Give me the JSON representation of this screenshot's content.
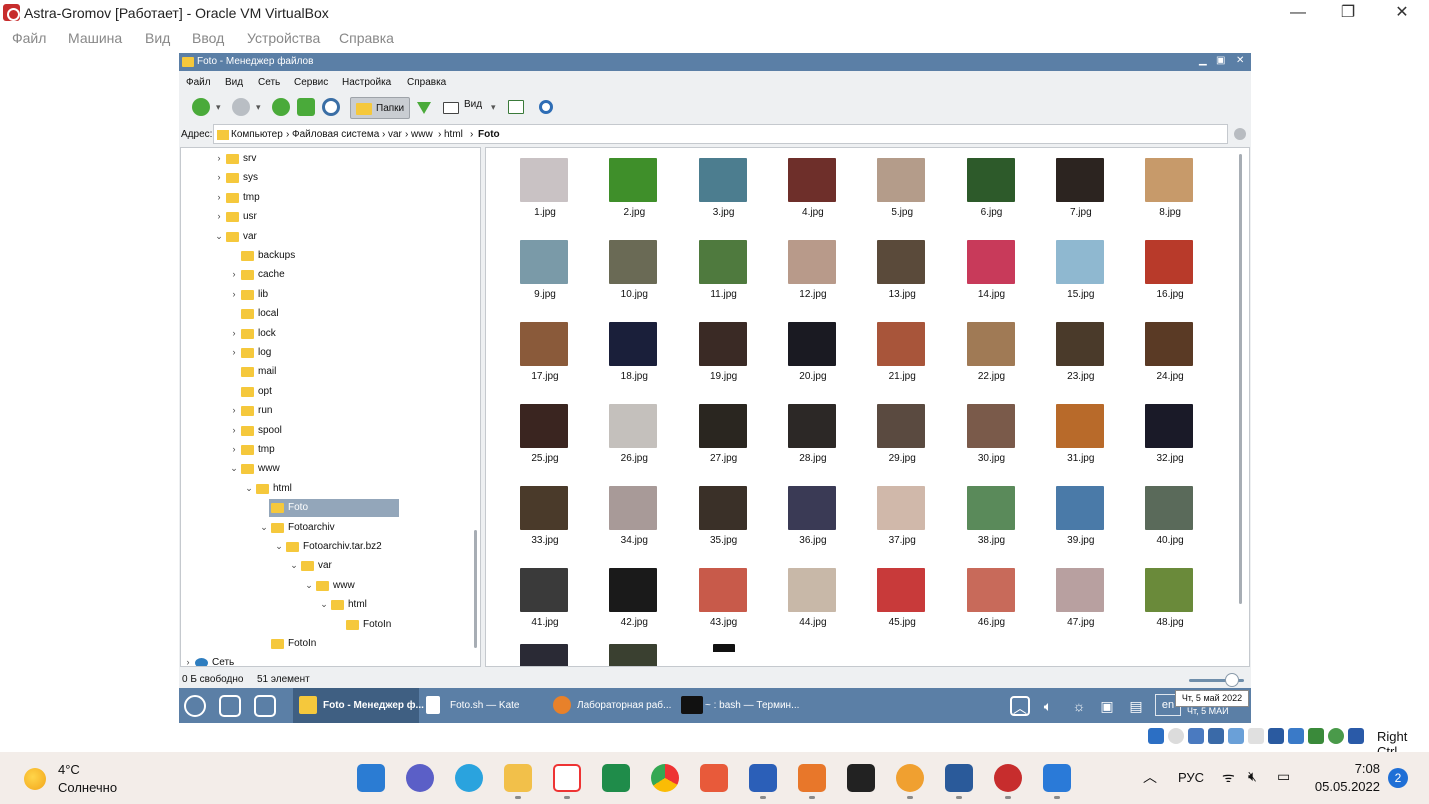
{
  "host": {
    "title": "Astra-Gromov [Работает] - Oracle VM VirtualBox",
    "menu": [
      "Файл",
      "Машина",
      "Вид",
      "Ввод",
      "Устройства",
      "Справка"
    ],
    "host_key_label": "Right Ctrl"
  },
  "filemanager": {
    "title": "Foto - Менеджер файлов",
    "menu": [
      "Файл",
      "Вид",
      "Сеть",
      "Сервис",
      "Настройка",
      "Справка"
    ],
    "toolbar": {
      "folders_label": "Папки",
      "view_label": "Вид"
    },
    "address": {
      "label": "Адрес:",
      "crumbs": [
        "Компьютер",
        "Файловая система",
        "var",
        "www",
        "html",
        "Foto"
      ]
    },
    "tree": [
      {
        "label": "srv",
        "depth": 0,
        "exp": ">"
      },
      {
        "label": "sys",
        "depth": 0,
        "exp": ">"
      },
      {
        "label": "tmp",
        "depth": 0,
        "exp": ">"
      },
      {
        "label": "usr",
        "depth": 0,
        "exp": ">"
      },
      {
        "label": "var",
        "depth": 0,
        "exp": "v"
      },
      {
        "label": "backups",
        "depth": 1,
        "exp": ""
      },
      {
        "label": "cache",
        "depth": 1,
        "exp": ">"
      },
      {
        "label": "lib",
        "depth": 1,
        "exp": ">"
      },
      {
        "label": "local",
        "depth": 1,
        "exp": ""
      },
      {
        "label": "lock",
        "depth": 1,
        "exp": ">"
      },
      {
        "label": "log",
        "depth": 1,
        "exp": ">"
      },
      {
        "label": "mail",
        "depth": 1,
        "exp": ""
      },
      {
        "label": "opt",
        "depth": 1,
        "exp": ""
      },
      {
        "label": "run",
        "depth": 1,
        "exp": ">"
      },
      {
        "label": "spool",
        "depth": 1,
        "exp": ">"
      },
      {
        "label": "tmp",
        "depth": 1,
        "exp": ">"
      },
      {
        "label": "www",
        "depth": 1,
        "exp": "v"
      },
      {
        "label": "html",
        "depth": 2,
        "exp": "v"
      },
      {
        "label": "Foto",
        "depth": 3,
        "exp": "",
        "selected": true
      },
      {
        "label": "Fotoarchiv",
        "depth": 3,
        "exp": "v"
      },
      {
        "label": "Fotoarchiv.tar.bz2",
        "depth": 4,
        "exp": "v"
      },
      {
        "label": "var",
        "depth": 5,
        "exp": "v"
      },
      {
        "label": "www",
        "depth": 6,
        "exp": "v"
      },
      {
        "label": "html",
        "depth": 7,
        "exp": "v"
      },
      {
        "label": "FotoIn",
        "depth": 8,
        "exp": ""
      },
      {
        "label": "FotoIn",
        "depth": 3,
        "exp": ""
      },
      {
        "label": "Сеть",
        "depth": -1,
        "exp": ">"
      }
    ],
    "files": [
      "1.jpg",
      "2.jpg",
      "3.jpg",
      "4.jpg",
      "5.jpg",
      "6.jpg",
      "7.jpg",
      "8.jpg",
      "9.jpg",
      "10.jpg",
      "11.jpg",
      "12.jpg",
      "13.jpg",
      "14.jpg",
      "15.jpg",
      "16.jpg",
      "17.jpg",
      "18.jpg",
      "19.jpg",
      "20.jpg",
      "21.jpg",
      "22.jpg",
      "23.jpg",
      "24.jpg",
      "25.jpg",
      "26.jpg",
      "27.jpg",
      "28.jpg",
      "29.jpg",
      "30.jpg",
      "31.jpg",
      "32.jpg",
      "33.jpg",
      "34.jpg",
      "35.jpg",
      "36.jpg",
      "37.jpg",
      "38.jpg",
      "39.jpg",
      "40.jpg",
      "41.jpg",
      "42.jpg",
      "43.jpg",
      "44.jpg",
      "45.jpg",
      "46.jpg",
      "47.jpg",
      "48.jpg"
    ],
    "thumb_colors": [
      "#c9c2c4",
      "#3f8f2a",
      "#4c7d8f",
      "#6e2f2a",
      "#b49c8a",
      "#2d5a2a",
      "#2c2420",
      "#c79a6a",
      "#7a9aa8",
      "#6a6a55",
      "#4f7a3e",
      "#b89a8a",
      "#5a4a3a",
      "#c83a5a",
      "#8fb8d0",
      "#b83a2a",
      "#8a5a3a",
      "#1a1f3a",
      "#3a2a25",
      "#1a1a22",
      "#a8553a",
      "#a07a55",
      "#4a3a2a",
      "#5a3a25",
      "#3a2520",
      "#c4c0bc",
      "#2a2620",
      "#2c2826",
      "#5a4a40",
      "#7a5a4a",
      "#b86a2a",
      "#1a1a28",
      "#4a3a2a",
      "#a89a98",
      "#3a3028",
      "#3a3a55",
      "#d0b8aa",
      "#5a8a5a",
      "#4a7aa8",
      "#5a6a5a",
      "#3a3a3a",
      "#1a1a1a",
      "#c85a4a",
      "#c8b8a8",
      "#c83a3a",
      "#c86a5a",
      "#b8a0a0",
      "#6a8a3a"
    ],
    "status": {
      "free": "0 Б свободно",
      "count": "51 элемент"
    }
  },
  "guest_taskbar": {
    "tasks": [
      {
        "label": "Foto - Менеджер ф...",
        "active": true
      },
      {
        "label": "Foto.sh — Kate",
        "active": false
      },
      {
        "label": "Лабораторная раб...",
        "active": false
      },
      {
        "label": "~ : bash — Термин...",
        "active": false
      }
    ],
    "lang": "en",
    "date_text": "Чт, 5 МАЙ",
    "tooltip": "Чт, 5 май 2022"
  },
  "windows_taskbar": {
    "weather_temp": "4°C",
    "weather_desc": "Солнечно",
    "lang": "РУС",
    "time": "7:08",
    "date": "05.05.2022",
    "notification_count": "2"
  }
}
